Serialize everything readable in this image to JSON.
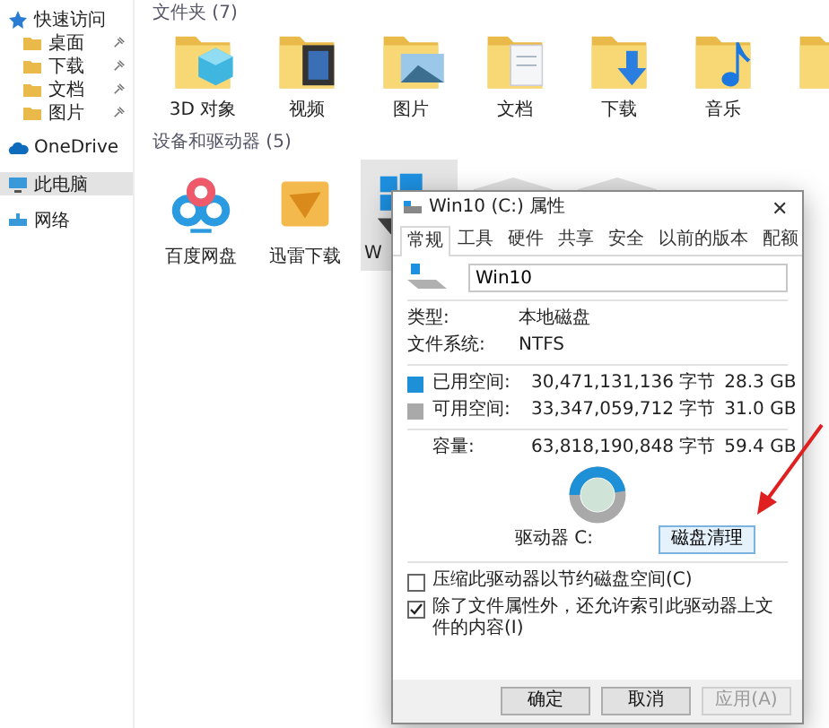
{
  "sidebar": {
    "items": [
      {
        "label": "快速访问",
        "kind": "star",
        "pinned": false,
        "selected": false
      },
      {
        "label": "桌面",
        "kind": "folder",
        "pinned": true,
        "selected": false
      },
      {
        "label": "下载",
        "kind": "folder",
        "pinned": true,
        "selected": false
      },
      {
        "label": "文档",
        "kind": "folder",
        "pinned": true,
        "selected": false
      },
      {
        "label": "图片",
        "kind": "folder",
        "pinned": true,
        "selected": false
      },
      {
        "label": "OneDrive",
        "kind": "cloud",
        "pinned": false,
        "selected": false
      },
      {
        "label": "此电脑",
        "kind": "pc",
        "pinned": false,
        "selected": true
      },
      {
        "label": "网络",
        "kind": "network",
        "pinned": false,
        "selected": false
      }
    ]
  },
  "folders": {
    "header": "文件夹 (7)",
    "items": [
      {
        "label": "3D 对象",
        "kind": "cube"
      },
      {
        "label": "视频",
        "kind": "film"
      },
      {
        "label": "图片",
        "kind": "photo"
      },
      {
        "label": "文档",
        "kind": "doc"
      },
      {
        "label": "下载",
        "kind": "download"
      },
      {
        "label": "音乐",
        "kind": "music"
      },
      {
        "kind": "plain"
      }
    ]
  },
  "devices": {
    "header": "设备和驱动器 (5)",
    "items": [
      {
        "label": "百度网盘",
        "kind": "cloud-app"
      },
      {
        "label": "迅雷下载",
        "kind": "bird-app"
      },
      {
        "label": "W",
        "kind": "windows-drive",
        "selected": true
      },
      {
        "kind": "drive"
      },
      {
        "kind": "drive"
      }
    ]
  },
  "dialog": {
    "title": "Win10 (C:) 属性",
    "close": "✕",
    "tabs": [
      {
        "label": "常规",
        "selected": true
      },
      {
        "label": "工具",
        "selected": false
      },
      {
        "label": "硬件",
        "selected": false
      },
      {
        "label": "共享",
        "selected": false
      },
      {
        "label": "安全",
        "selected": false
      },
      {
        "label": "以前的版本",
        "selected": false
      },
      {
        "label": "配额",
        "selected": false
      }
    ],
    "name": "Win10",
    "info": [
      {
        "label": "类型:",
        "value": "本地磁盘"
      },
      {
        "label": "文件系统:",
        "value": "NTFS"
      }
    ],
    "space": [
      {
        "label": "已用空间:",
        "bytes": "30,471,131,136 字节",
        "size": "28.3 GB",
        "color": "#1e90d8"
      },
      {
        "label": "可用空间:",
        "bytes": "33,347,059,712 字节",
        "size": "31.0 GB",
        "color": "#a9a9a9"
      }
    ],
    "capacity": {
      "label": "容量:",
      "bytes": "63,818,190,848 字节",
      "size": "59.4 GB"
    },
    "drive_label": "驱动器 C:",
    "cleanup_button": "磁盘清理",
    "options": [
      {
        "label": "压缩此驱动器以节约磁盘空间(C)",
        "checked": false
      },
      {
        "label": "除了文件属性外，还允许索引此驱动器上文件的内容(I)",
        "checked": true
      }
    ],
    "buttons": [
      {
        "label": "确定",
        "disabled": false
      },
      {
        "label": "取消",
        "disabled": false
      },
      {
        "label": "应用(A)",
        "disabled": true
      }
    ]
  }
}
